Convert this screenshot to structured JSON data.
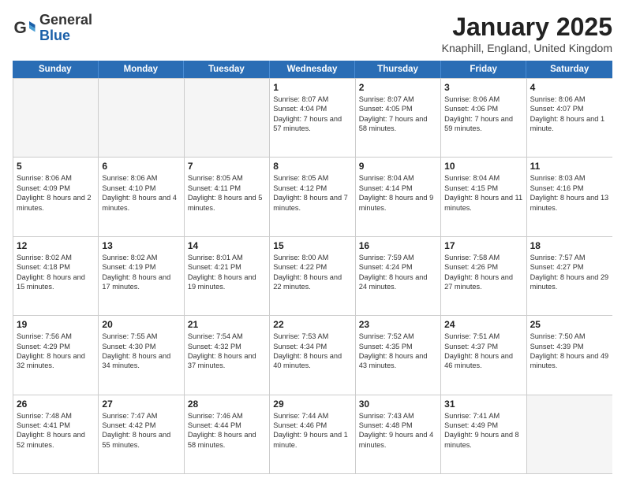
{
  "header": {
    "logo": {
      "general": "General",
      "blue": "Blue"
    },
    "title": "January 2025",
    "location": "Knaphill, England, United Kingdom"
  },
  "days_of_week": [
    "Sunday",
    "Monday",
    "Tuesday",
    "Wednesday",
    "Thursday",
    "Friday",
    "Saturday"
  ],
  "weeks": [
    [
      {
        "day": "",
        "empty": true,
        "detail": ""
      },
      {
        "day": "",
        "empty": true,
        "detail": ""
      },
      {
        "day": "",
        "empty": true,
        "detail": ""
      },
      {
        "day": "1",
        "empty": false,
        "detail": "Sunrise: 8:07 AM\nSunset: 4:04 PM\nDaylight: 7 hours and 57 minutes."
      },
      {
        "day": "2",
        "empty": false,
        "detail": "Sunrise: 8:07 AM\nSunset: 4:05 PM\nDaylight: 7 hours and 58 minutes."
      },
      {
        "day": "3",
        "empty": false,
        "detail": "Sunrise: 8:06 AM\nSunset: 4:06 PM\nDaylight: 7 hours and 59 minutes."
      },
      {
        "day": "4",
        "empty": false,
        "detail": "Sunrise: 8:06 AM\nSunset: 4:07 PM\nDaylight: 8 hours and 1 minute."
      }
    ],
    [
      {
        "day": "5",
        "empty": false,
        "detail": "Sunrise: 8:06 AM\nSunset: 4:09 PM\nDaylight: 8 hours and 2 minutes."
      },
      {
        "day": "6",
        "empty": false,
        "detail": "Sunrise: 8:06 AM\nSunset: 4:10 PM\nDaylight: 8 hours and 4 minutes."
      },
      {
        "day": "7",
        "empty": false,
        "detail": "Sunrise: 8:05 AM\nSunset: 4:11 PM\nDaylight: 8 hours and 5 minutes."
      },
      {
        "day": "8",
        "empty": false,
        "detail": "Sunrise: 8:05 AM\nSunset: 4:12 PM\nDaylight: 8 hours and 7 minutes."
      },
      {
        "day": "9",
        "empty": false,
        "detail": "Sunrise: 8:04 AM\nSunset: 4:14 PM\nDaylight: 8 hours and 9 minutes."
      },
      {
        "day": "10",
        "empty": false,
        "detail": "Sunrise: 8:04 AM\nSunset: 4:15 PM\nDaylight: 8 hours and 11 minutes."
      },
      {
        "day": "11",
        "empty": false,
        "detail": "Sunrise: 8:03 AM\nSunset: 4:16 PM\nDaylight: 8 hours and 13 minutes."
      }
    ],
    [
      {
        "day": "12",
        "empty": false,
        "detail": "Sunrise: 8:02 AM\nSunset: 4:18 PM\nDaylight: 8 hours and 15 minutes."
      },
      {
        "day": "13",
        "empty": false,
        "detail": "Sunrise: 8:02 AM\nSunset: 4:19 PM\nDaylight: 8 hours and 17 minutes."
      },
      {
        "day": "14",
        "empty": false,
        "detail": "Sunrise: 8:01 AM\nSunset: 4:21 PM\nDaylight: 8 hours and 19 minutes."
      },
      {
        "day": "15",
        "empty": false,
        "detail": "Sunrise: 8:00 AM\nSunset: 4:22 PM\nDaylight: 8 hours and 22 minutes."
      },
      {
        "day": "16",
        "empty": false,
        "detail": "Sunrise: 7:59 AM\nSunset: 4:24 PM\nDaylight: 8 hours and 24 minutes."
      },
      {
        "day": "17",
        "empty": false,
        "detail": "Sunrise: 7:58 AM\nSunset: 4:26 PM\nDaylight: 8 hours and 27 minutes."
      },
      {
        "day": "18",
        "empty": false,
        "detail": "Sunrise: 7:57 AM\nSunset: 4:27 PM\nDaylight: 8 hours and 29 minutes."
      }
    ],
    [
      {
        "day": "19",
        "empty": false,
        "detail": "Sunrise: 7:56 AM\nSunset: 4:29 PM\nDaylight: 8 hours and 32 minutes."
      },
      {
        "day": "20",
        "empty": false,
        "detail": "Sunrise: 7:55 AM\nSunset: 4:30 PM\nDaylight: 8 hours and 34 minutes."
      },
      {
        "day": "21",
        "empty": false,
        "detail": "Sunrise: 7:54 AM\nSunset: 4:32 PM\nDaylight: 8 hours and 37 minutes."
      },
      {
        "day": "22",
        "empty": false,
        "detail": "Sunrise: 7:53 AM\nSunset: 4:34 PM\nDaylight: 8 hours and 40 minutes."
      },
      {
        "day": "23",
        "empty": false,
        "detail": "Sunrise: 7:52 AM\nSunset: 4:35 PM\nDaylight: 8 hours and 43 minutes."
      },
      {
        "day": "24",
        "empty": false,
        "detail": "Sunrise: 7:51 AM\nSunset: 4:37 PM\nDaylight: 8 hours and 46 minutes."
      },
      {
        "day": "25",
        "empty": false,
        "detail": "Sunrise: 7:50 AM\nSunset: 4:39 PM\nDaylight: 8 hours and 49 minutes."
      }
    ],
    [
      {
        "day": "26",
        "empty": false,
        "detail": "Sunrise: 7:48 AM\nSunset: 4:41 PM\nDaylight: 8 hours and 52 minutes."
      },
      {
        "day": "27",
        "empty": false,
        "detail": "Sunrise: 7:47 AM\nSunset: 4:42 PM\nDaylight: 8 hours and 55 minutes."
      },
      {
        "day": "28",
        "empty": false,
        "detail": "Sunrise: 7:46 AM\nSunset: 4:44 PM\nDaylight: 8 hours and 58 minutes."
      },
      {
        "day": "29",
        "empty": false,
        "detail": "Sunrise: 7:44 AM\nSunset: 4:46 PM\nDaylight: 9 hours and 1 minute."
      },
      {
        "day": "30",
        "empty": false,
        "detail": "Sunrise: 7:43 AM\nSunset: 4:48 PM\nDaylight: 9 hours and 4 minutes."
      },
      {
        "day": "31",
        "empty": false,
        "detail": "Sunrise: 7:41 AM\nSunset: 4:49 PM\nDaylight: 9 hours and 8 minutes."
      },
      {
        "day": "",
        "empty": true,
        "detail": ""
      }
    ]
  ]
}
